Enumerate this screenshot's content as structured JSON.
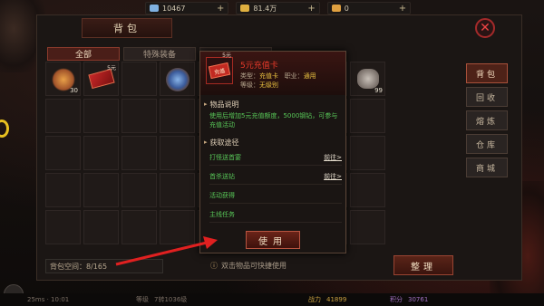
{
  "resources": [
    {
      "icon": "diamond-icon",
      "value": "10467",
      "plus": "+",
      "color": "#7fb0e0"
    },
    {
      "icon": "gold-icon",
      "value": "81.4万",
      "plus": "+",
      "color": "#e0b040"
    },
    {
      "icon": "ticket-icon",
      "value": "0",
      "plus": "+",
      "color": "#e0a040"
    }
  ],
  "panel": {
    "title": "背包",
    "close_glyph": "✕",
    "filter_tabs": [
      "全部",
      "特殊装备",
      ""
    ],
    "side_tabs": [
      "背包",
      "回收",
      "熔炼",
      "仓库",
      "商城"
    ],
    "capacity": "背包空间：8/165",
    "hint": "双击物品可快捷使用",
    "tidy_label": "整理"
  },
  "grid_items": [
    {
      "slot": 0,
      "type": "key",
      "count": "30",
      "tag": ""
    },
    {
      "slot": 1,
      "type": "red",
      "count": "",
      "tag": "5元"
    },
    {
      "slot": 3,
      "type": "orb",
      "count": "",
      "tag": ""
    },
    {
      "slot": 8,
      "type": "stone",
      "count": "99",
      "tag": ""
    }
  ],
  "popup": {
    "icon_tag": "5元",
    "icon_text": "充值",
    "item_name": "5元充值卡",
    "type_label": "类型：",
    "type_value": "充值卡",
    "job_label": "职业：",
    "job_value": "通用",
    "level_label": "等级：",
    "level_value": "无级别",
    "desc_title": "物品说明",
    "desc": "使用后增加5元充值额度，5000钢钻，可参与充值活动",
    "source_title": "获取途径",
    "routes": [
      {
        "name": "打怪送首宴",
        "go": "前往>"
      },
      {
        "name": "首杀送钻",
        "go": "前往>"
      },
      {
        "name": "活动获得",
        "go": ""
      },
      {
        "name": "主线任务",
        "go": ""
      }
    ],
    "use_label": "使用"
  },
  "bottom": {
    "left": "25ms · 10:01",
    "level_label": "等级",
    "level_value": "7转1036级",
    "power_label": "战力",
    "power_value": "41899",
    "value2_label": "积分",
    "value2": "30761"
  },
  "colors": {
    "accent_red": "#a42a22",
    "green_text": "#58c858",
    "arrow_red": "#e02020"
  }
}
